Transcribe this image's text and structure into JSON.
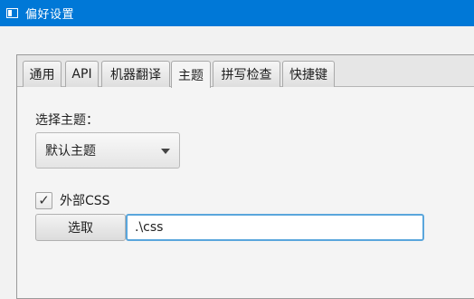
{
  "window": {
    "title": "偏好设置"
  },
  "tabs": [
    {
      "label": "通用",
      "selected": false
    },
    {
      "label": "API",
      "selected": false
    },
    {
      "label": "机器翻译",
      "selected": false
    },
    {
      "label": "主题",
      "selected": true
    },
    {
      "label": "拼写检查",
      "selected": false
    },
    {
      "label": "快捷键",
      "selected": false
    }
  ],
  "theme": {
    "select_label": "选择主题：",
    "selected_theme": "默认主题",
    "external_css_label": "外部CSS",
    "external_css_checked": true,
    "browse_button": "选取",
    "css_path": ".\\css"
  },
  "colors": {
    "titlebar": "#0078d7",
    "focus_border": "#5aa6dc"
  }
}
